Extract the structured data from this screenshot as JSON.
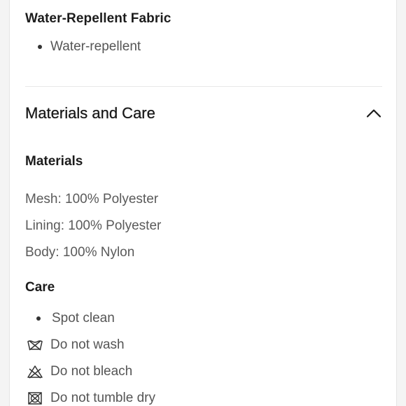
{
  "feature": {
    "title": "Water-Repellent Fabric",
    "bullets": [
      "Water-repellent"
    ]
  },
  "section": {
    "title": "Materials and Care",
    "expanded": true,
    "toggle_icon": "chevron-up-icon"
  },
  "materials": {
    "heading": "Materials",
    "lines": [
      "Mesh: 100% Polyester",
      "Lining: 100% Polyester",
      "Body: 100% Nylon"
    ]
  },
  "care": {
    "heading": "Care",
    "items": [
      {
        "icon": "bullet-dot",
        "label": "Spot clean"
      },
      {
        "icon": "do-not-wash-icon",
        "label": "Do not wash"
      },
      {
        "icon": "do-not-bleach-icon",
        "label": "Do not bleach"
      },
      {
        "icon": "do-not-tumble-dry-icon",
        "label": "Do not tumble dry"
      }
    ]
  }
}
